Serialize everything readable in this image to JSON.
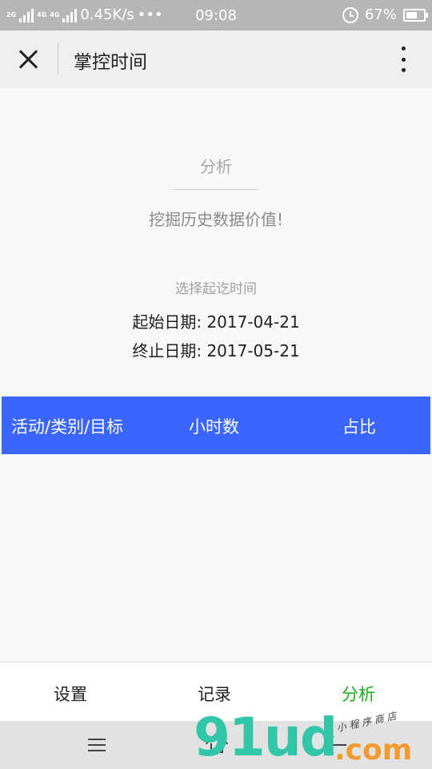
{
  "status_bar": {
    "network_1": "2G",
    "network_2": "4G",
    "network_3": "4G",
    "network_4": "2G",
    "speed": "0.45K/s",
    "dots": "•••",
    "time": "09:08",
    "battery": "67%",
    "battery_level": 0.67
  },
  "title_bar": {
    "title": "掌控时间"
  },
  "analysis": {
    "section_title": "分析",
    "subtitle": "挖掘历史数据价值!",
    "range_label": "选择起讫时间",
    "start_label": "起始日期: ",
    "start_date": "2017-04-21",
    "end_label": "终止日期: ",
    "end_date": "2017-05-21"
  },
  "table": {
    "columns": [
      "活动/类别/目标",
      "小时数",
      "占比"
    ],
    "rows": []
  },
  "tab_bar": {
    "items": [
      {
        "label": "设置",
        "active": false
      },
      {
        "label": "记录",
        "active": false
      },
      {
        "label": "分析",
        "active": true
      }
    ],
    "active_color": "#1aad19"
  },
  "colors": {
    "header_blue": "#3a66ff"
  },
  "watermark": {
    "logo": "91ud",
    "domain": ".com",
    "tagline": "小程序商店"
  }
}
